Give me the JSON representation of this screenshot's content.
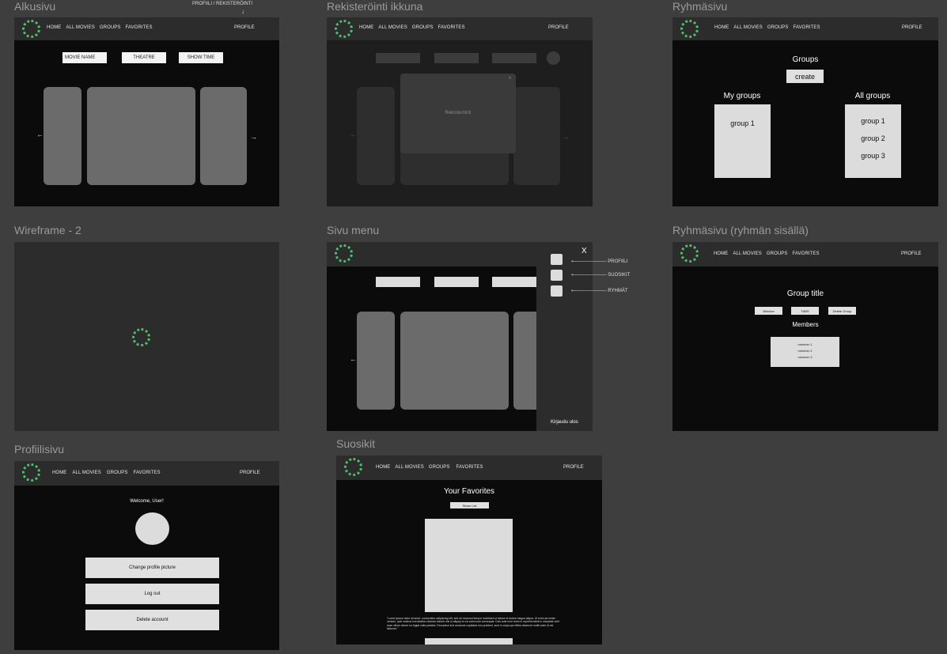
{
  "frames": {
    "alkusivu": {
      "title": "Alkusivu"
    },
    "rekisterointi": {
      "title": "Rekisteröinti ikkuna"
    },
    "ryhmasivu": {
      "title": "Ryhmäsivu"
    },
    "wireframe2": {
      "title": "Wireframe - 2"
    },
    "sivumenu": {
      "title": "Sivu menu"
    },
    "ryhmasivu_sisalla": {
      "title": "Ryhmäsivu (ryhmän sisällä)"
    },
    "profiilisivu": {
      "title": "Profiilisivu"
    },
    "suosikit": {
      "title": "Suosikit"
    }
  },
  "nav": {
    "home": "HOME",
    "all_movies": "ALL MOVIES",
    "groups": "GROUPS",
    "favorites": "FAVORITES",
    "profile": "PROFILE"
  },
  "annotation": {
    "profile_register": "PROFIILI / REKISTERÖINTI",
    "down_arrow": "↓"
  },
  "alkusivu": {
    "filters": [
      "MOVIE NAME",
      "THEATRE",
      "SHOW TIME"
    ],
    "left_arrow": "←",
    "right_arrow": "→"
  },
  "rekisterointi": {
    "modal_label": "Rekisteröinti",
    "close": "x",
    "left_arrow": "←",
    "right_arrow": "→"
  },
  "ryhmasivu": {
    "heading": "Groups",
    "create": "create",
    "my_groups": "My groups",
    "all_groups": "All groups",
    "my_group_items": [
      "group 1"
    ],
    "all_group_items": [
      "group 1",
      "group 2",
      "group 3"
    ]
  },
  "sivumenu": {
    "close": "X",
    "items": [
      "PROFIILI",
      "SUOSIKIT",
      "RYHMÄT"
    ],
    "logout": "Kirjaudu ulos",
    "left_arrow": "←"
  },
  "ryhmasivu_sisalla": {
    "title": "Group title",
    "buttons": [
      "Window",
      "TABS",
      "Delete Group"
    ],
    "members_heading": "Members",
    "members": [
      "member 1",
      "member 2",
      "member 3"
    ]
  },
  "profiilisivu": {
    "welcome": "Welcome, User!",
    "change_picture": "Change profile picture",
    "logout": "Log out",
    "delete": "Delete account"
  },
  "suosikit": {
    "heading": "Your Favorites",
    "share": "Share List",
    "lorem": "\"Lorem ipsum dolor sit amet, consectetur adipiscing elit, sed do eiusmod tempor incididunt ut labore et dolore magna aliqua. Ut enim ad minim veniam, quis nostrud exercitation ullamco laboris nisi ut aliquip ex ea commodo consequat. Duis aute irure dolor in reprehenderit in voluptate velit esse cillum dolore eu fugiat nulla pariatur. Excepteur sint occaecat cupidatat non proident, sunt in culpa qui officia deserunt mollit anim id est laborum.\""
  },
  "colors": {
    "logo_green": "#4fbf6f",
    "frame_bg": "#0b0b0b",
    "nav_bg": "#2c2c2c",
    "canvas_bg": "#3e3e3e"
  }
}
